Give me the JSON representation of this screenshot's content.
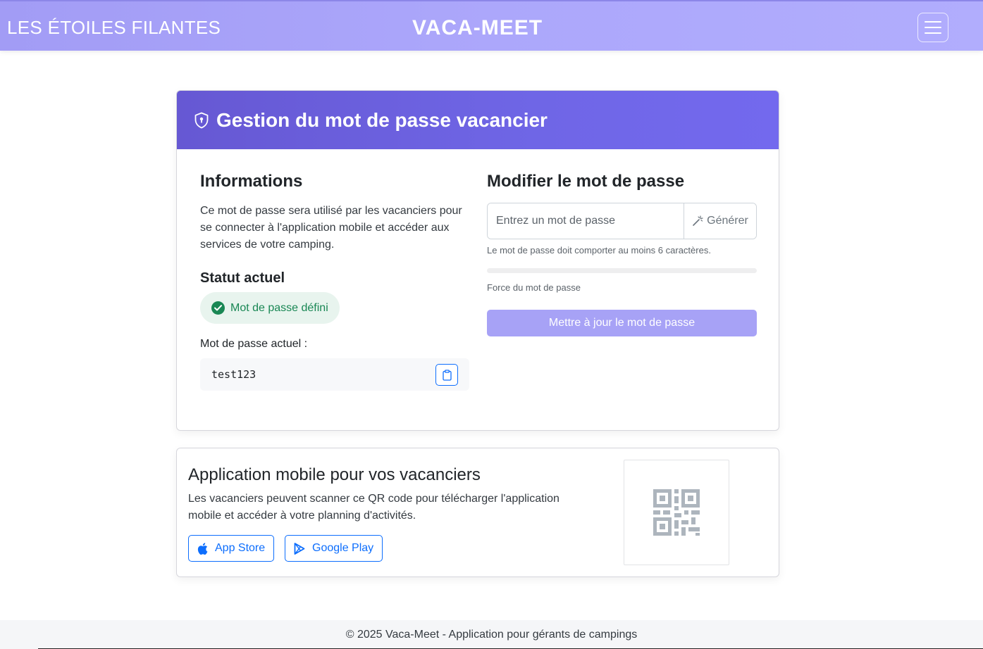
{
  "navbar": {
    "brand_left": "LES ÉTOILES FILANTES",
    "brand_center": "VACA-MEET",
    "menu_icon": "hamburger-icon"
  },
  "password_card": {
    "title": "Gestion du mot de passe vacancier",
    "title_icon": "shield-lock-icon",
    "info": {
      "heading": "Informations",
      "text": "Ce mot de passe sera utilisé par les vacanciers pour se connecter à l'application mobile et accéder aux services de votre camping."
    },
    "status": {
      "heading": "Statut actuel",
      "badge": "Mot de passe défini",
      "badge_icon": "check-circle-icon",
      "badge_color": "#198754"
    },
    "current": {
      "label": "Mot de passe actuel :",
      "value": "test123",
      "copy_icon": "clipboard-icon"
    },
    "modify": {
      "heading": "Modifier le mot de passe",
      "input_placeholder": "Entrez un mot de passe",
      "input_value": "",
      "generate_label": "Générer",
      "generate_icon": "magic-wand-icon",
      "hint": "Le mot de passe doit comporter au moins 6 caractères.",
      "strength_label": "Force du mot de passe",
      "strength_value": 0,
      "update_label": "Mettre à jour le mot de passe"
    }
  },
  "app_card": {
    "title": "Application mobile pour vos vacanciers",
    "text": "Les vacanciers peuvent scanner ce QR code pour télécharger l'application mobile et accéder à votre planning d'activités.",
    "app_store_label": "App Store",
    "app_store_icon": "apple-icon",
    "google_play_label": "Google Play",
    "google_play_icon": "google-play-icon",
    "qr_icon": "qr-code-icon"
  },
  "footer": {
    "text": "© 2025 Vaca-Meet - Application pour gérants de campings"
  },
  "colors": {
    "navbar": "#aca7fb",
    "header_gradient_start": "#6658d3",
    "header_gradient_end": "#7369ee",
    "primary": "#0d6efd",
    "update_button": "#a7a2f6"
  }
}
